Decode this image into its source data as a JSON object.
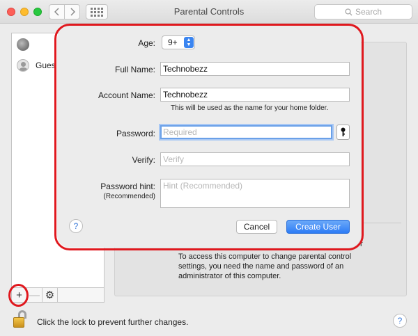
{
  "window": {
    "title": "Parental Controls",
    "search_placeholder": "Search"
  },
  "sidebar": {
    "users": [
      {
        "label": ""
      },
      {
        "label": "Gues"
      }
    ],
    "add_label": "+",
    "remove_label": "—",
    "settings_icon": "⚙"
  },
  "background": {
    "info_text": "To access this computer to change parental control settings, you need the name and password of an administrator of this computer.",
    "right_fragment": "r",
    "lock_text": "Click the lock to prevent further changes."
  },
  "dialog": {
    "age_label": "Age:",
    "age_value": "9+",
    "full_name_label": "Full Name:",
    "full_name_value": "Technobezz",
    "account_name_label": "Account Name:",
    "account_name_value": "Technobezz",
    "account_note": "This will be used as the name for your home folder.",
    "password_label": "Password:",
    "password_placeholder": "Required",
    "verify_label": "Verify:",
    "verify_placeholder": "Verify",
    "hint_label": "Password hint:",
    "hint_sublabel": "(Recommended)",
    "hint_placeholder": "Hint (Recommended)",
    "cancel_label": "Cancel",
    "create_label": "Create User",
    "help_label": "?"
  },
  "colors": {
    "annotation": "#e0181e",
    "accent": "#2d7cf6"
  }
}
